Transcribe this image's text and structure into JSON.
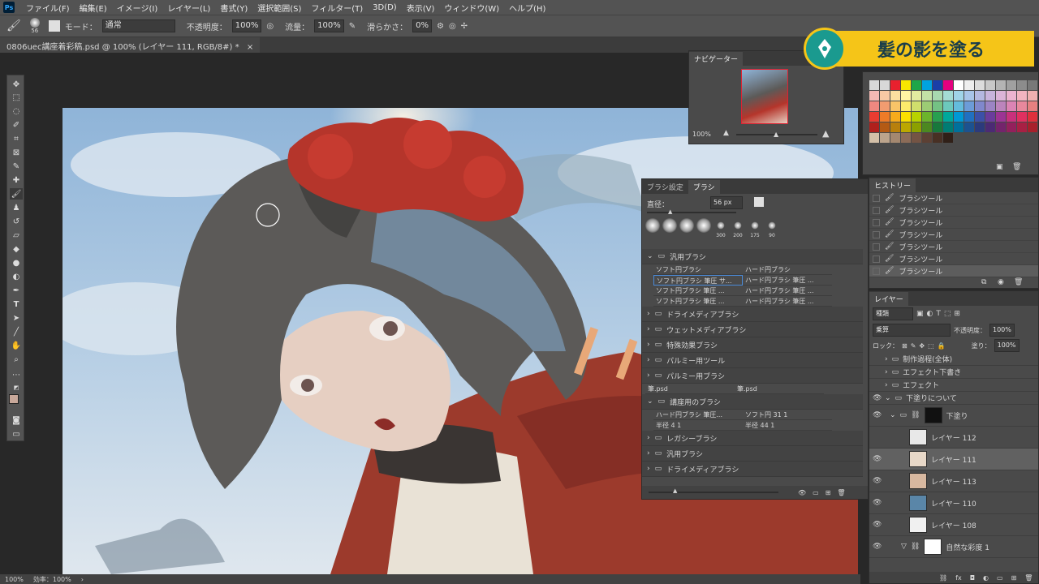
{
  "menubar": {
    "items": [
      "ファイル(F)",
      "編集(E)",
      "イメージ(I)",
      "レイヤー(L)",
      "書式(Y)",
      "選択範囲(S)",
      "フィルター(T)",
      "3D(D)",
      "表示(V)",
      "ウィンドウ(W)",
      "ヘルプ(H)"
    ]
  },
  "options": {
    "brush_size": "56",
    "mode_label": "モード：",
    "mode_value": "通常",
    "opacity_label": "不透明度：",
    "opacity_value": "100%",
    "flow_label": "流量：",
    "flow_value": "100%",
    "smoothing_label": "滑らかさ：",
    "smoothing_value": "0%"
  },
  "document": {
    "tab_title": "0806uec講座着彩稿.psd @ 100% (レイヤー 111, RGB/8#) *",
    "zoom": "100%",
    "efficiency": "効率：100%"
  },
  "title_badge": {
    "text": "髪の影を塗る"
  },
  "navigator": {
    "tab": "ナビゲーター",
    "zoom": "100%"
  },
  "swatches": {
    "colors": [
      "#d8d8d8",
      "#d8d8d8",
      "#e8212e",
      "#f7e600",
      "#1da649",
      "#00a3e0",
      "#1a3fa8",
      "#e4007f",
      "#ffffff",
      "#eeeeee",
      "#dcdcdc",
      "#c8c8c8",
      "#b4b4b4",
      "#a0a0a0",
      "#8c8c8c",
      "#787878",
      "#f4b9b4",
      "#f8c9a4",
      "#fbe0a0",
      "#fff5a4",
      "#e2eba0",
      "#c4e1a6",
      "#a8d8b0",
      "#a4dcd4",
      "#a0d4e8",
      "#a8c4e8",
      "#b4b8e0",
      "#c8b4dc",
      "#dcb4d8",
      "#ecb4d0",
      "#f2b4c0",
      "#f0b0b0",
      "#ee8880",
      "#f29c70",
      "#f8c468",
      "#fceb6c",
      "#d0df6c",
      "#9ccc74",
      "#74c284",
      "#6cc8bc",
      "#64bcdc",
      "#6c9cd8",
      "#8088cc",
      "#9c84c4",
      "#bc84bc",
      "#dc84b4",
      "#e8889c",
      "#e68080",
      "#e83c30",
      "#ee7b28",
      "#f6ab1c",
      "#fae000",
      "#b8d200",
      "#6cb42c",
      "#28a050",
      "#00a89c",
      "#0098d4",
      "#2070c0",
      "#3c50a8",
      "#6a3c9c",
      "#9c3494",
      "#c8307c",
      "#e03060",
      "#e0303c",
      "#b0201c",
      "#b45a14",
      "#b8800c",
      "#bca800",
      "#8ca000",
      "#4c8820",
      "#18783c",
      "#007c74",
      "#00709c",
      "#1c5290",
      "#2c3a7c",
      "#4c2a74",
      "#74246c",
      "#94205c",
      "#a82044",
      "#a8202c",
      "#d4c0a8",
      "#bca48c",
      "#a48870",
      "#8c6c58",
      "#745444",
      "#5c4034",
      "#483024",
      "#302018"
    ]
  },
  "history": {
    "tab": "ヒストリー",
    "items": [
      "ブラシツール",
      "ブラシツール",
      "ブラシツール",
      "ブラシツール",
      "ブラシツール",
      "ブラシツール",
      "ブラシツール"
    ]
  },
  "brush_panel": {
    "tab_settings": "ブラシ設定",
    "tab_brush": "ブラシ",
    "size_label": "直径：",
    "size_value": "56 px",
    "tips": [
      "",
      "",
      "",
      "",
      "300",
      "200",
      "175",
      "90"
    ],
    "groups": [
      {
        "name": "汎用ブラシ",
        "brushes": [
          [
            "ソフト円ブラシ",
            "ハード円ブラシ"
          ],
          [
            "ソフト円ブラシ 筆圧 サ...",
            "ハード円ブラシ 筆圧 ..."
          ],
          [
            "ソフト円ブラシ 筆圧 ...",
            "ハード円ブラシ 筆圧 ..."
          ],
          [
            "ソフト円ブラシ 筆圧 ...",
            "ハード円ブラシ 筆圧 ..."
          ]
        ]
      },
      {
        "name": "ドライメディアブラシ"
      },
      {
        "name": "ウェットメディアブラシ"
      },
      {
        "name": "特殊効果ブラシ"
      },
      {
        "name": "パルミー用ツール"
      },
      {
        "name": "パルミー用ブラシ"
      }
    ],
    "loose": [
      "筆.psd",
      "筆.psd"
    ],
    "course_group": {
      "name": "講座用のブラシ",
      "brushes": [
        [
          "ハード円ブラシ 筆圧...",
          "ソフト円 31 1"
        ],
        [
          "半径 4 1",
          "半径 44 1"
        ]
      ]
    },
    "tail_groups": [
      "レガシーブラシ",
      "汎用ブラシ",
      "ドライメディアブラシ"
    ]
  },
  "layers_panel": {
    "tab": "レイヤー",
    "filter": "種類",
    "blend": "乗算",
    "opacity_label": "不透明度：",
    "opacity_value": "100%",
    "lock_label": "ロック：",
    "fill_label": "塗り：",
    "fill_value": "100%",
    "layers": [
      {
        "name": "制作過程(全体)",
        "type": "group",
        "visible": false
      },
      {
        "name": "エフェクト下書き",
        "type": "group",
        "visible": false
      },
      {
        "name": "エフェクト",
        "type": "group",
        "visible": false
      },
      {
        "name": "下塗りについて",
        "type": "group",
        "visible": true
      },
      {
        "name": "下塗り",
        "type": "masked",
        "visible": true
      },
      {
        "name": "レイヤー 112",
        "type": "layer",
        "visible": false
      },
      {
        "name": "レイヤー 111",
        "type": "layer",
        "visible": true,
        "active": true
      },
      {
        "name": "レイヤー 113",
        "type": "layer",
        "visible": true
      },
      {
        "name": "レイヤー 110",
        "type": "layer",
        "visible": true
      },
      {
        "name": "レイヤー 108",
        "type": "layer",
        "visible": true
      },
      {
        "name": "自然な彩度 1",
        "type": "adjustment",
        "visible": true
      }
    ]
  }
}
